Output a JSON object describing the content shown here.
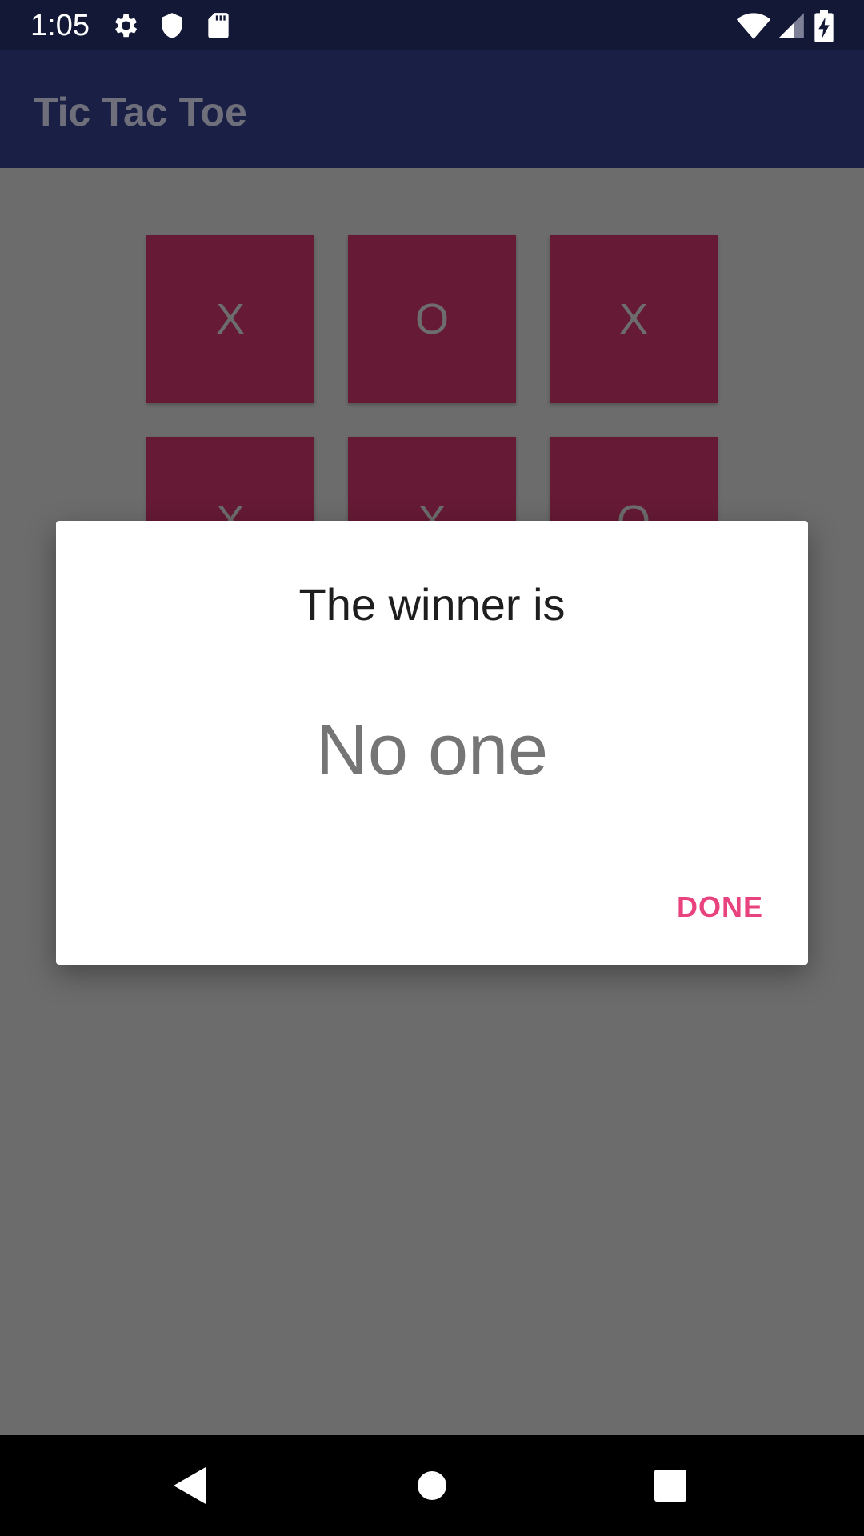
{
  "status_bar": {
    "time": "1:05",
    "icons": [
      "gear-icon",
      "shield-icon",
      "sd-card-icon",
      "wifi-icon",
      "cell-signal-icon",
      "battery-charging-icon"
    ]
  },
  "app_bar": {
    "title": "Tic Tac Toe"
  },
  "board": {
    "cells": [
      "X",
      "O",
      "X",
      "X",
      "X",
      "O"
    ]
  },
  "dialog": {
    "title": "The winner is",
    "winner": "No one",
    "done_label": "DONE"
  },
  "nav_bar": {
    "buttons": [
      "back-icon",
      "home-icon",
      "recents-icon"
    ]
  },
  "colors": {
    "status_bar": "#121836",
    "app_bar": "#1a1f45",
    "cell": "#661a35",
    "accent": "#e8437e",
    "scrim_background": "#6c6c6c"
  }
}
